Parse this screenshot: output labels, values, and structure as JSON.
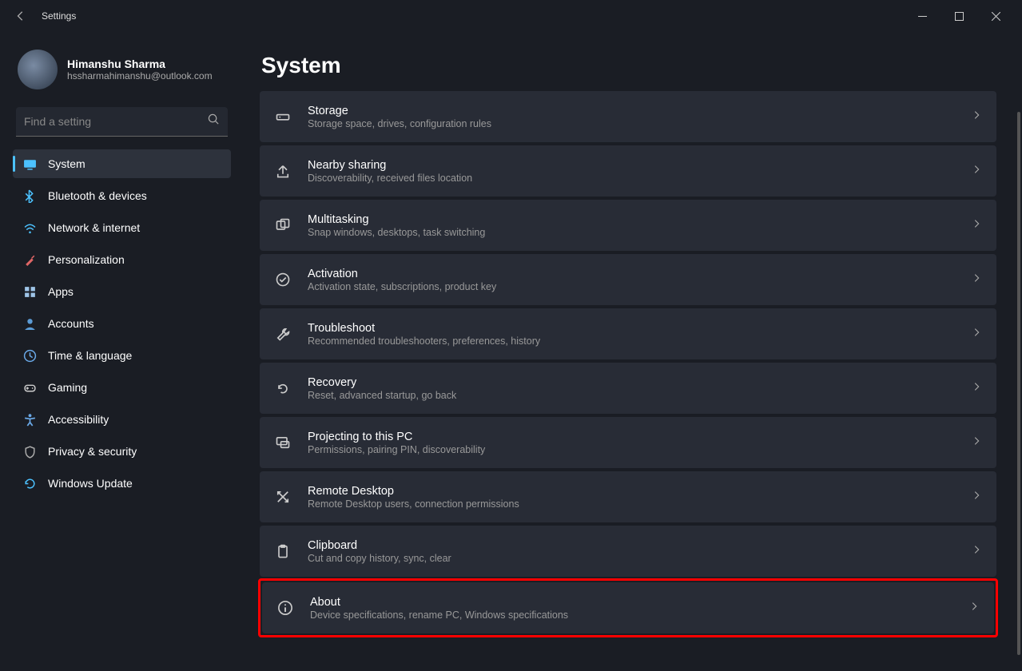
{
  "titlebar": {
    "title": "Settings"
  },
  "profile": {
    "name": "Himanshu Sharma",
    "email": "hssharmahimanshu@outlook.com"
  },
  "search": {
    "placeholder": "Find a setting"
  },
  "nav": {
    "items": [
      {
        "label": "System",
        "icon": "display",
        "color": "#4cc2ff",
        "active": true
      },
      {
        "label": "Bluetooth & devices",
        "icon": "bluetooth",
        "color": "#4cc2ff"
      },
      {
        "label": "Network & internet",
        "icon": "wifi",
        "color": "#4cc2ff"
      },
      {
        "label": "Personalization",
        "icon": "brush",
        "color": "#e06666"
      },
      {
        "label": "Apps",
        "icon": "grid",
        "color": "#9fc5e8"
      },
      {
        "label": "Accounts",
        "icon": "person",
        "color": "#5b9bd5"
      },
      {
        "label": "Time & language",
        "icon": "clock",
        "color": "#6aa9e8"
      },
      {
        "label": "Gaming",
        "icon": "gamepad",
        "color": "#ccc"
      },
      {
        "label": "Accessibility",
        "icon": "accessibility",
        "color": "#6aa9e8"
      },
      {
        "label": "Privacy & security",
        "icon": "shield",
        "color": "#aaa"
      },
      {
        "label": "Windows Update",
        "icon": "update",
        "color": "#4cc2ff"
      }
    ]
  },
  "main": {
    "title": "System",
    "items": [
      {
        "title": "Storage",
        "desc": "Storage space, drives, configuration rules",
        "icon": "storage"
      },
      {
        "title": "Nearby sharing",
        "desc": "Discoverability, received files location",
        "icon": "share"
      },
      {
        "title": "Multitasking",
        "desc": "Snap windows, desktops, task switching",
        "icon": "multitask"
      },
      {
        "title": "Activation",
        "desc": "Activation state, subscriptions, product key",
        "icon": "check"
      },
      {
        "title": "Troubleshoot",
        "desc": "Recommended troubleshooters, preferences, history",
        "icon": "wrench"
      },
      {
        "title": "Recovery",
        "desc": "Reset, advanced startup, go back",
        "icon": "recovery"
      },
      {
        "title": "Projecting to this PC",
        "desc": "Permissions, pairing PIN, discoverability",
        "icon": "project"
      },
      {
        "title": "Remote Desktop",
        "desc": "Remote Desktop users, connection permissions",
        "icon": "remote"
      },
      {
        "title": "Clipboard",
        "desc": "Cut and copy history, sync, clear",
        "icon": "clipboard"
      },
      {
        "title": "About",
        "desc": "Device specifications, rename PC, Windows specifications",
        "icon": "info",
        "highlighted": true
      }
    ]
  }
}
